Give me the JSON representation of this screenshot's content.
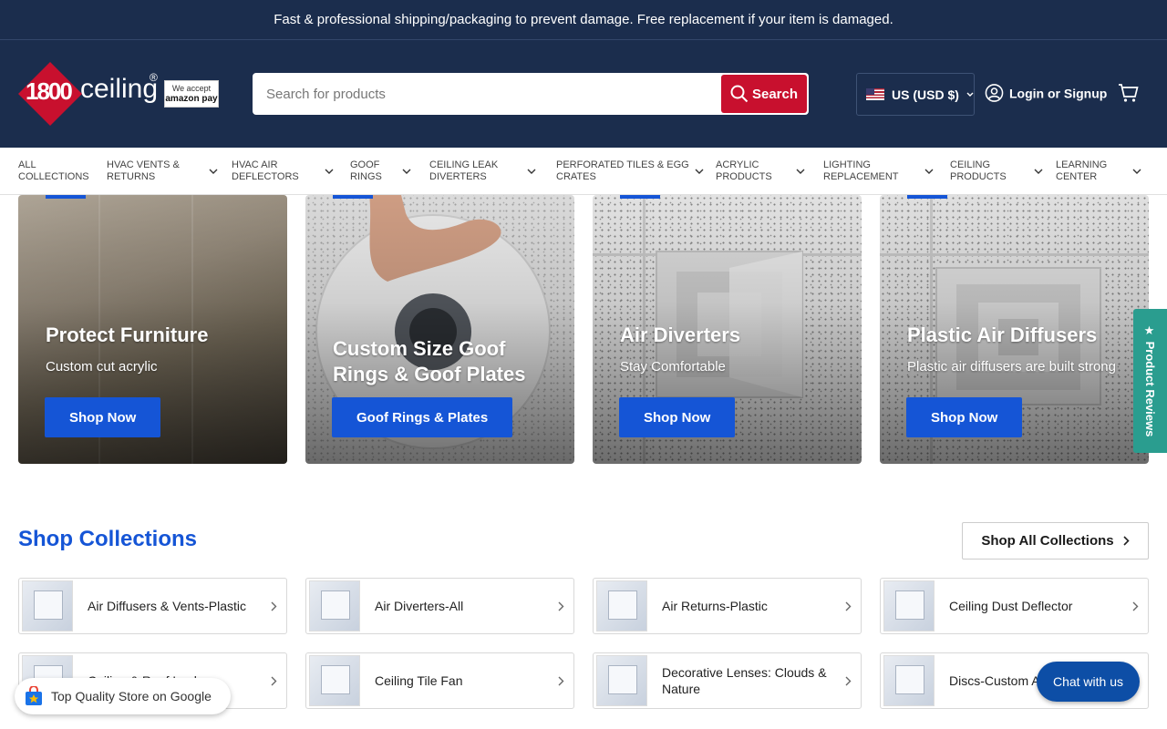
{
  "announcement": "Fast & professional shipping/packaging to prevent damage. Free replacement if your item is damaged.",
  "logo": {
    "number": "1800",
    "word": "ceiling",
    "reg": "®",
    "badge_line1": "We accept",
    "badge_line2": "amazon pay"
  },
  "search": {
    "placeholder": "Search for products",
    "button": "Search"
  },
  "currency": "US (USD $)",
  "login": "Login or Signup",
  "nav": [
    {
      "line1": "ALL",
      "line2": "COLLECTIONS",
      "dropdown": false
    },
    {
      "line1": "HVAC VENTS &",
      "line2": "RETURNS",
      "dropdown": true
    },
    {
      "line1": "HVAC AIR",
      "line2": "DEFLECTORS",
      "dropdown": true
    },
    {
      "line1": "GOOF",
      "line2": "RINGS",
      "dropdown": true
    },
    {
      "line1": "CEILING LEAK",
      "line2": "DIVERTERS",
      "dropdown": true
    },
    {
      "line1": "PERFORATED TILES & EGG",
      "line2": "CRATES",
      "dropdown": true
    },
    {
      "line1": "ACRYLIC",
      "line2": "PRODUCTS",
      "dropdown": true
    },
    {
      "line1": "LIGHTING",
      "line2": "REPLACEMENT",
      "dropdown": true
    },
    {
      "line1": "CEILING",
      "line2": "PRODUCTS",
      "dropdown": true
    },
    {
      "line1": "LEARNING",
      "line2": "CENTER",
      "dropdown": true
    }
  ],
  "hero_cards": [
    {
      "title": "Protect Furniture",
      "subtitle": "Custom cut acrylic",
      "button": "Shop Now"
    },
    {
      "title": "Custom Size Goof Rings & Goof Plates",
      "subtitle": "",
      "button": "Goof Rings & Plates"
    },
    {
      "title": "Air Diverters",
      "subtitle": "Stay Comfortable",
      "button": "Shop Now"
    },
    {
      "title": "Plastic Air Diffusers",
      "subtitle": "Plastic air diffusers are built strong",
      "button": "Shop Now"
    }
  ],
  "collections": {
    "title": "Shop Collections",
    "all_button": "Shop All Collections",
    "items": [
      "Air Diffusers & Vents-Plastic",
      "Air Diverters-All",
      "Air Returns-Plastic",
      "Ceiling Dust Deflector",
      "Ceiling & Roof Leak",
      "Ceiling Tile Fan",
      "Decorative Lenses: Clouds & Nature",
      "Discs-Custom A"
    ]
  },
  "reviews_tab": "★ Product Reviews",
  "google_badge": "Top Quality Store on Google",
  "chat": "Chat with us",
  "colors": {
    "navy": "#1b2d4d",
    "accent_red": "#c8102e",
    "brand_blue": "#1555d6",
    "teal": "#2a9d8f"
  }
}
